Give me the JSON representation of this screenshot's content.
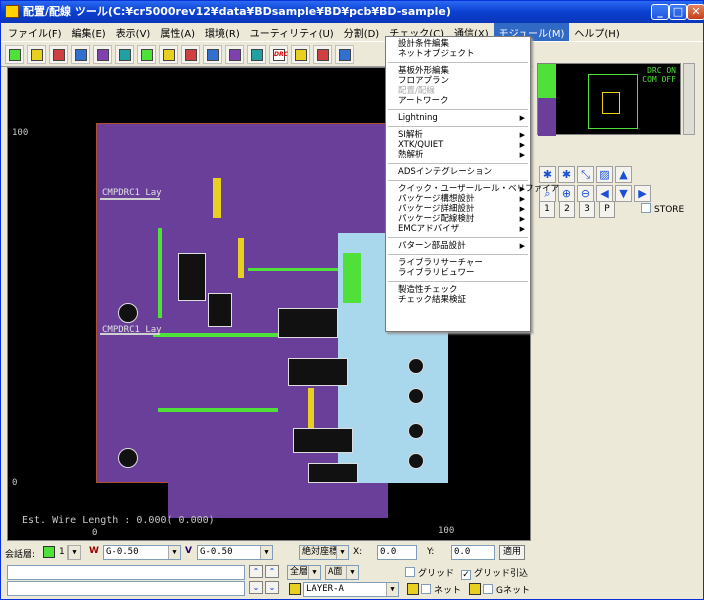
{
  "window": {
    "title": "配置/配線 ツール(C:¥cr5000rev12¥data¥BDsample¥BD¥pcb¥BD-sample)"
  },
  "menubar": [
    {
      "label": "ファイル(F)"
    },
    {
      "label": "編集(E)"
    },
    {
      "label": "表示(V)"
    },
    {
      "label": "属性(A)"
    },
    {
      "label": "環境(R)"
    },
    {
      "label": "ユーティリティ(U)"
    },
    {
      "label": "分割(D)"
    },
    {
      "label": "チェック(C)"
    },
    {
      "label": "通信(X)"
    },
    {
      "label": "モジュール(M)",
      "active": true
    },
    {
      "label": "ヘルプ(H)"
    }
  ],
  "toolbar": {
    "icons": [
      "place-icon",
      "rotate-icon",
      "move-icon",
      "copy-icon",
      "route-icon",
      "via-icon",
      "component-icon",
      "net-icon",
      "layer-icon",
      "pad-icon",
      "trace-icon",
      "plane-icon",
      "drc-icon",
      "measure-icon",
      "undo-icon",
      "redo-icon"
    ],
    "drc_label": "DRC"
  },
  "canvas": {
    "axis_y_100": "100",
    "axis_y_0": "0",
    "axis_x_0": "0",
    "axis_x_100": "100",
    "ref1": "CMPDRC1 Lay",
    "ref2": "CMPDRC1 Lay",
    "status": "Est. Wire Length : 0.000( 0.000)"
  },
  "module_menu": [
    {
      "label": "設計条件編集"
    },
    {
      "label": "ネットオブジェクト"
    },
    {
      "sep": true
    },
    {
      "label": "基板外形編集"
    },
    {
      "label": "フロアプラン"
    },
    {
      "label": "配置/配線",
      "disabled": true
    },
    {
      "label": "アートワーク"
    },
    {
      "sep": true
    },
    {
      "label": "Lightning",
      "sub": true
    },
    {
      "sep": true
    },
    {
      "label": "SI解析",
      "sub": true
    },
    {
      "label": "XTK/QUIET",
      "sub": true
    },
    {
      "label": "熱解析",
      "sub": true
    },
    {
      "sep": true
    },
    {
      "label": "ADSインテグレーション"
    },
    {
      "sep": true
    },
    {
      "label": "クイック・ユーザールール・ベリファイア",
      "sub": true
    },
    {
      "label": "パッケージ構想設計",
      "sub": true
    },
    {
      "label": "パッケージ詳細設計",
      "sub": true
    },
    {
      "label": "パッケージ配線検討",
      "sub": true
    },
    {
      "label": "EMCアドバイザ",
      "sub": true
    },
    {
      "sep": true
    },
    {
      "label": "パターン部品設計",
      "sub": true
    },
    {
      "sep": true
    },
    {
      "label": "ライブラリサーチャー"
    },
    {
      "label": "ライブラリビュワー"
    },
    {
      "sep": true
    },
    {
      "label": "製造性チェック"
    },
    {
      "label": "チェック結果検証"
    }
  ],
  "minimap": {
    "drc": "DRC ON",
    "com": "COM OFF"
  },
  "right_panel": {
    "btn1": "1",
    "btn2": "2",
    "btn3": "3",
    "btnP": "P",
    "store": "STORE"
  },
  "bottom": {
    "layer_label": "会話層:",
    "layer_value": "1",
    "width1": "G-0.50",
    "width2": "G-0.50",
    "coord_mode": "絶対座標",
    "x_label": "X:",
    "x_value": "0.0",
    "y_label": "Y:",
    "y_value": "0.0",
    "apply": "適用",
    "all_layers": "全層",
    "face": "A面",
    "grid": "グリッド",
    "grid_snap": "グリッド引込",
    "layer_name": "LAYER-A",
    "net": "ネット",
    "gnet": "Gネット"
  },
  "colors": {
    "accent": "#316ac5",
    "board": "#6a3f9a",
    "copper": "#4fe03a"
  }
}
